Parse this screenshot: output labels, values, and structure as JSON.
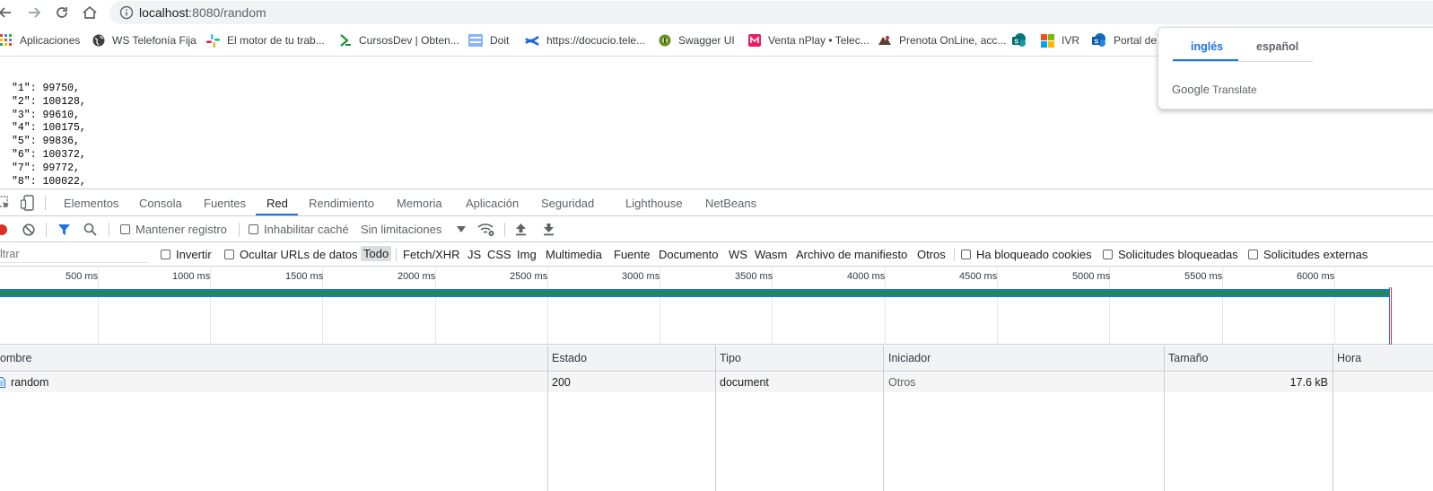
{
  "browser": {
    "url_host": "localhost",
    "url_rest": ":8080/random"
  },
  "bookmarks": [
    {
      "label": "Aplicaciones",
      "icon": "apps-grid-icon"
    },
    {
      "label": "WS Telefonía Fija",
      "icon": "globe-icon"
    },
    {
      "label": "El motor de tu trab...",
      "icon": "slack-icon"
    },
    {
      "label": "CursosDev | Obten...",
      "icon": "chevron-dev-icon"
    },
    {
      "label": "Doit",
      "icon": "doit-icon"
    },
    {
      "label": "https://docucio.tele...",
      "icon": "confluence-icon"
    },
    {
      "label": "Swagger UI",
      "icon": "swagger-icon"
    },
    {
      "label": "Venta nPlay • Telec...",
      "icon": "m-badge-icon"
    },
    {
      "label": "Prenota OnLine, acc...",
      "icon": "prenota-icon"
    },
    {
      "label": "",
      "icon": "sharepoint-icon"
    },
    {
      "label": "IVR",
      "icon": "microsoft-icon"
    },
    {
      "label": "Portal de",
      "icon": "sharepoint-icon"
    }
  ],
  "json_lines": [
    "\"1\": 99750,",
    "\"2\": 100128,",
    "\"3\": 99610,",
    "\"4\": 100175,",
    "\"5\": 99836,",
    "\"6\": 100372,",
    "\"7\": 99772,",
    "\"8\": 100022,"
  ],
  "translate": {
    "lang_from": "inglés",
    "lang_to": "español",
    "brand_google": "Google",
    "brand_translate": "Translate"
  },
  "devtools": {
    "tabs": [
      "Elementos",
      "Consola",
      "Fuentes",
      "Red",
      "Rendimiento",
      "Memoria",
      "Aplicación",
      "Seguridad",
      "Lighthouse",
      "NetBeans"
    ],
    "active_tab": "Red",
    "controls": {
      "preserve_log": "Mantener registro",
      "disable_cache": "Inhabilitar caché",
      "throttling": "Sin limitaciones"
    },
    "filter": {
      "placeholder": "ltrar",
      "invert": "Invertir",
      "hide_data_urls": "Ocultar URLs de datos",
      "types": [
        "Todo",
        "Fetch/XHR",
        "JS",
        "CSS",
        "Img",
        "Multimedia",
        "Fuente",
        "Documento",
        "WS",
        "Wasm",
        "Archivo de manifiesto",
        "Otros"
      ],
      "blocked_cookies": "Ha bloqueado cookies",
      "blocked_requests": "Solicitudes bloqueadas",
      "third_party": "Solicitudes externas"
    },
    "timeline_ticks": [
      "500 ms",
      "1000 ms",
      "1500 ms",
      "2000 ms",
      "2500 ms",
      "3000 ms",
      "3500 ms",
      "4000 ms",
      "4500 ms",
      "5000 ms",
      "5500 ms",
      "6000 ms"
    ],
    "table": {
      "columns": [
        "ombre",
        "Estado",
        "Tipo",
        "Iniciador",
        "Tamaño",
        "Hora"
      ],
      "rows": [
        {
          "name": "random",
          "status": "200",
          "type": "document",
          "initiator": "Otros",
          "size": "17.6 kB",
          "time": ""
        }
      ]
    },
    "colors": {
      "accent": "#1a73e8",
      "record": "#d93025",
      "waterfall_green": "#1e8e3e"
    }
  }
}
